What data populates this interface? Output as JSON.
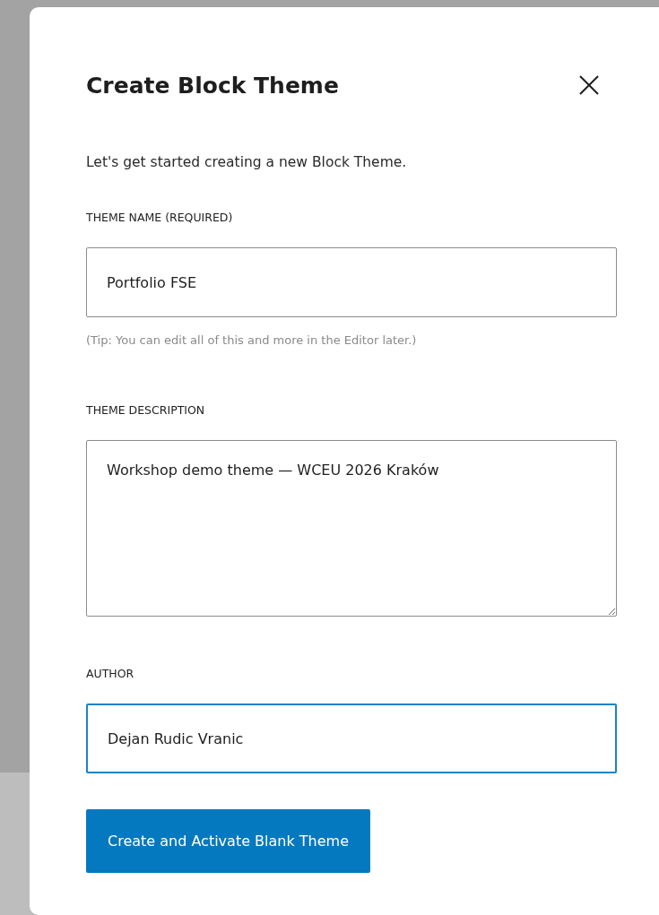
{
  "dialog": {
    "title": "Create Block Theme",
    "intro": "Let's get started creating a new Block Theme.",
    "fields": [
      {
        "kind": "input",
        "label": "THEME NAME (REQUIRED)",
        "value": "Portfolio FSE",
        "focused": false,
        "help": "(Tip: You can edit all of this and more in the Editor later.)"
      },
      {
        "kind": "textarea",
        "label": "THEME DESCRIPTION",
        "value": "Workshop demo theme — WCEU 2026 Kraków",
        "focused": false
      },
      {
        "kind": "input",
        "label": "AUTHOR",
        "value": "Dejan Rudic Vranic",
        "focused": true
      }
    ],
    "button": "Create and Activate Blank Theme"
  }
}
